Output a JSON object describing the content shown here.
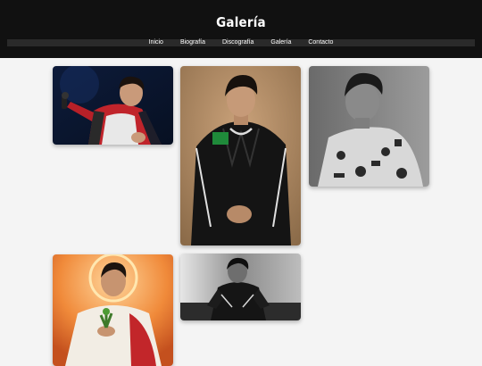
{
  "header": {
    "title": "Galería"
  },
  "nav": {
    "items": [
      {
        "label": "Inicio"
      },
      {
        "label": "Biografía"
      },
      {
        "label": "Discografía"
      },
      {
        "label": "Galería"
      },
      {
        "label": "Contacto"
      }
    ]
  },
  "gallery": {
    "photos": [
      {
        "subject": "concert-performer-photo"
      },
      {
        "subject": "portrait-black-jacket-photo"
      },
      {
        "subject": "bw-portrait-photo"
      },
      {
        "subject": "religious-art-portrait-photo"
      },
      {
        "subject": "bw-crouching-photo"
      }
    ]
  },
  "colors": {
    "header_bg": "#111111",
    "page_bg": "#f4f4f4",
    "nav_bar": "#2a2a2a",
    "text": "#ffffff"
  }
}
